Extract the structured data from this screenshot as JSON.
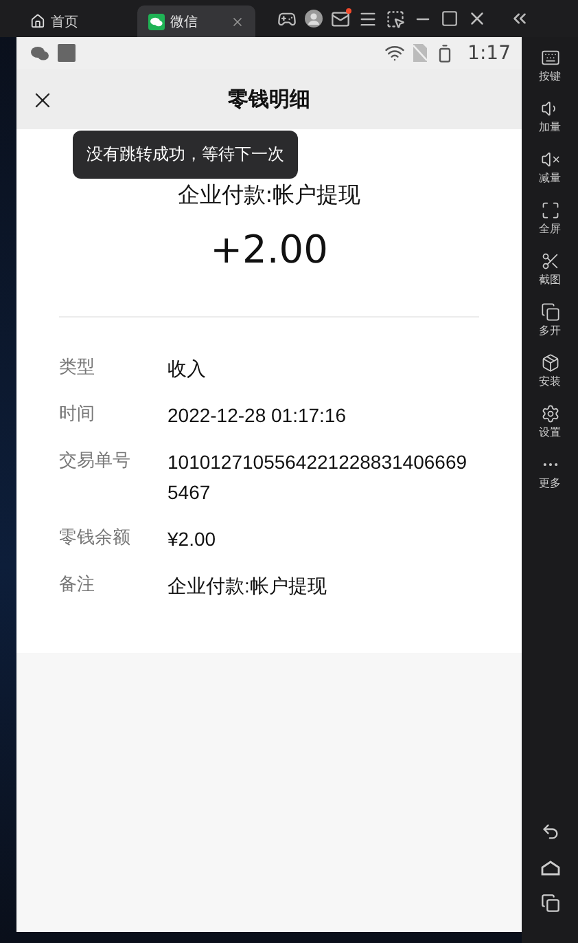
{
  "emulator_tabs": [
    {
      "label": "首页",
      "selected": false
    },
    {
      "label": "微信",
      "selected": true
    }
  ],
  "emulator_sidebar": [
    {
      "label": "按键"
    },
    {
      "label": "加量"
    },
    {
      "label": "减量"
    },
    {
      "label": "全屏"
    },
    {
      "label": "截图"
    },
    {
      "label": "多开"
    },
    {
      "label": "安装"
    },
    {
      "label": "设置"
    },
    {
      "label": "更多"
    }
  ],
  "status_bar": {
    "time": "1:17"
  },
  "header": {
    "title": "零钱明细"
  },
  "toast": "没有跳转成功，等待下一次",
  "summary": {
    "description": "企业付款:帐户提现",
    "amount": "+2.00"
  },
  "details": [
    {
      "label": "类型",
      "value": "收入"
    },
    {
      "label": "时间",
      "value": "2022-12-28 01:17:16"
    },
    {
      "label": "交易单号",
      "value": "10101271055642212288314066695467"
    },
    {
      "label": "零钱余额",
      "value": "¥2.00"
    },
    {
      "label": "备注",
      "value": "企业付款:帐户提现"
    }
  ]
}
